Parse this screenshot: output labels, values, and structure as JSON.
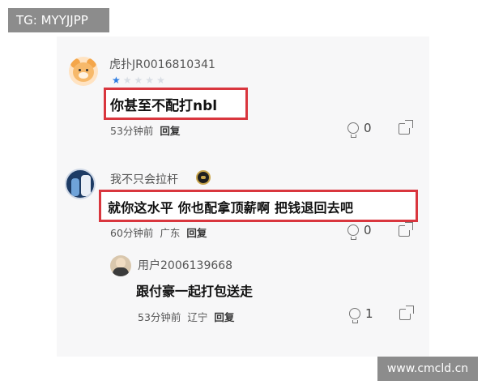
{
  "watermarks": {
    "top_left": "TG: MYYJJPP",
    "bottom_right": "www.cmcld.cn"
  },
  "comments": [
    {
      "username": "虎扑JR0016810341",
      "rating_stars": 1,
      "rating_total": 5,
      "content": "你甚至不配打nbl",
      "time": "53分钟前",
      "location": "",
      "reply_label": "回复",
      "likes": "0"
    },
    {
      "username": "我不只会拉杆",
      "content": "就你这水平  你也配拿顶薪啊   把钱退回去吧",
      "time": "60分钟前",
      "location": "广东",
      "reply_label": "回复",
      "likes": "0"
    },
    {
      "username": "用户2006139668",
      "content": "跟付豪一起打包送走",
      "time": "53分钟前",
      "location": "辽宁",
      "reply_label": "回复",
      "likes": "1"
    }
  ],
  "colors": {
    "highlight_border": "#d9363e",
    "star_active": "#2e7de1",
    "star_inactive": "#d8dde4"
  },
  "icons": [
    "light-bulb-icon",
    "share-icon",
    "star-icon",
    "verified-badge-icon"
  ]
}
